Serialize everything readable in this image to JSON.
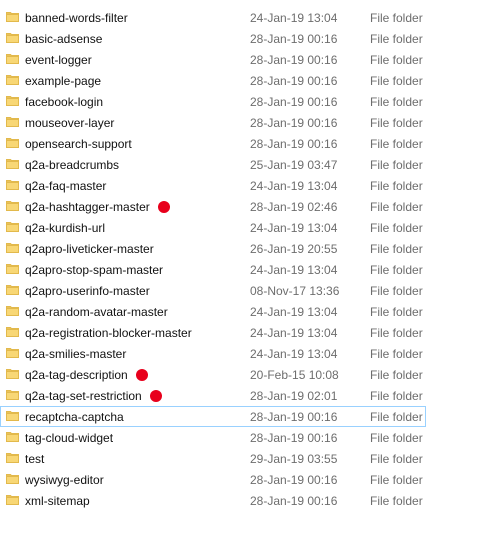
{
  "colors": {
    "folder_body": "#F8D775",
    "folder_edge": "#E2B94C",
    "folder_tab": "#E9C25B",
    "marker": "#E8001C",
    "focus_outline": "#99D1FF"
  },
  "icon": "folder-icon",
  "files": [
    {
      "name": "banned-words-filter",
      "date": "24-Jan-19 13:04",
      "type": "File folder",
      "marked": false,
      "focused": false
    },
    {
      "name": "basic-adsense",
      "date": "28-Jan-19 00:16",
      "type": "File folder",
      "marked": false,
      "focused": false
    },
    {
      "name": "event-logger",
      "date": "28-Jan-19 00:16",
      "type": "File folder",
      "marked": false,
      "focused": false
    },
    {
      "name": "example-page",
      "date": "28-Jan-19 00:16",
      "type": "File folder",
      "marked": false,
      "focused": false
    },
    {
      "name": "facebook-login",
      "date": "28-Jan-19 00:16",
      "type": "File folder",
      "marked": false,
      "focused": false
    },
    {
      "name": "mouseover-layer",
      "date": "28-Jan-19 00:16",
      "type": "File folder",
      "marked": false,
      "focused": false
    },
    {
      "name": "opensearch-support",
      "date": "28-Jan-19 00:16",
      "type": "File folder",
      "marked": false,
      "focused": false
    },
    {
      "name": "q2a-breadcrumbs",
      "date": "25-Jan-19 03:47",
      "type": "File folder",
      "marked": false,
      "focused": false
    },
    {
      "name": "q2a-faq-master",
      "date": "24-Jan-19 13:04",
      "type": "File folder",
      "marked": false,
      "focused": false
    },
    {
      "name": "q2a-hashtagger-master",
      "date": "28-Jan-19 02:46",
      "type": "File folder",
      "marked": true,
      "focused": false
    },
    {
      "name": "q2a-kurdish-url",
      "date": "24-Jan-19 13:04",
      "type": "File folder",
      "marked": false,
      "focused": false
    },
    {
      "name": "q2apro-liveticker-master",
      "date": "26-Jan-19 20:55",
      "type": "File folder",
      "marked": false,
      "focused": false
    },
    {
      "name": "q2apro-stop-spam-master",
      "date": "24-Jan-19 13:04",
      "type": "File folder",
      "marked": false,
      "focused": false
    },
    {
      "name": "q2apro-userinfo-master",
      "date": "08-Nov-17 13:36",
      "type": "File folder",
      "marked": false,
      "focused": false
    },
    {
      "name": "q2a-random-avatar-master",
      "date": "24-Jan-19 13:04",
      "type": "File folder",
      "marked": false,
      "focused": false
    },
    {
      "name": "q2a-registration-blocker-master",
      "date": "24-Jan-19 13:04",
      "type": "File folder",
      "marked": false,
      "focused": false
    },
    {
      "name": "q2a-smilies-master",
      "date": "24-Jan-19 13:04",
      "type": "File folder",
      "marked": false,
      "focused": false
    },
    {
      "name": "q2a-tag-description",
      "date": "20-Feb-15 10:08",
      "type": "File folder",
      "marked": true,
      "focused": false
    },
    {
      "name": "q2a-tag-set-restriction",
      "date": "28-Jan-19 02:01",
      "type": "File folder",
      "marked": true,
      "focused": false
    },
    {
      "name": "recaptcha-captcha",
      "date": "28-Jan-19 00:16",
      "type": "File folder",
      "marked": false,
      "focused": true
    },
    {
      "name": "tag-cloud-widget",
      "date": "28-Jan-19 00:16",
      "type": "File folder",
      "marked": false,
      "focused": false
    },
    {
      "name": "test",
      "date": "29-Jan-19 03:55",
      "type": "File folder",
      "marked": false,
      "focused": false
    },
    {
      "name": "wysiwyg-editor",
      "date": "28-Jan-19 00:16",
      "type": "File folder",
      "marked": false,
      "focused": false
    },
    {
      "name": "xml-sitemap",
      "date": "28-Jan-19 00:16",
      "type": "File folder",
      "marked": false,
      "focused": false
    }
  ]
}
